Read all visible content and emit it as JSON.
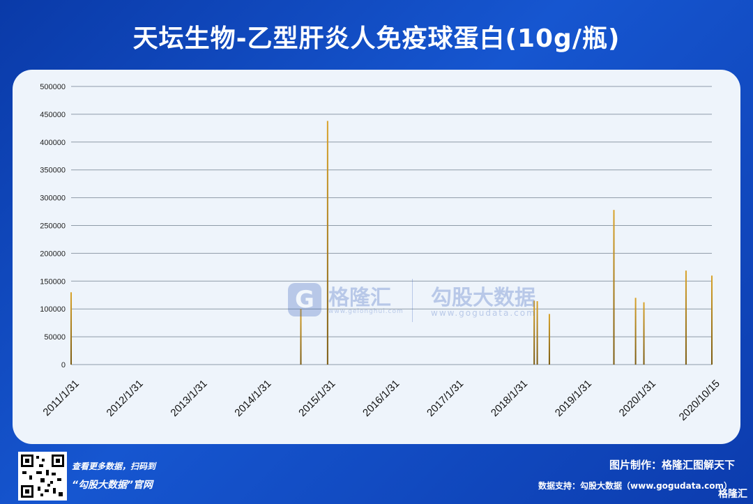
{
  "header": {
    "title": "天坛生物-乙型肝炎人免疫球蛋白(10g/瓶)"
  },
  "watermark": {
    "brand1": "格隆汇",
    "url1": "www.gelonghui.com",
    "brand2": "勾股大数据",
    "url2": "www.gogudata.com",
    "logo_letter": "G"
  },
  "footer": {
    "scan_text": "查看更多数据，扫码到",
    "site_text": "“勾股大数据”官网",
    "made_by": "图片制作：格隆汇图解天下",
    "data_support": "数据支持：勾股大数据（www.gogudata.com）",
    "corner_logo": "格隆汇"
  },
  "colors": {
    "bar": "#d9a32a",
    "bar_dark": "#7a5a10",
    "grid": "#8e9aa8",
    "panel": "#eef4fb"
  },
  "chart_data": {
    "type": "bar",
    "title": "天坛生物-乙型肝炎人免疫球蛋白(10g/瓶)",
    "ylim": [
      0,
      500000
    ],
    "yticks": [
      0,
      50000,
      100000,
      150000,
      200000,
      250000,
      300000,
      350000,
      400000,
      450000,
      500000
    ],
    "xlim": [
      "2011-01-31",
      "2020-10-15"
    ],
    "xtick_labels": [
      "2011/1/31",
      "2012/1/31",
      "2013/1/31",
      "2014/1/31",
      "2015/1/31",
      "2016/1/31",
      "2017/1/31",
      "2018/1/31",
      "2019/1/31",
      "2020/1/31",
      "2020/10/15"
    ],
    "grid": true,
    "bars": [
      {
        "date": "2011-01-31",
        "value": 130000
      },
      {
        "date": "2014-07-25",
        "value": 100000
      },
      {
        "date": "2014-12-20",
        "value": 438000
      },
      {
        "date": "2018-02-05",
        "value": 115000
      },
      {
        "date": "2018-02-22",
        "value": 114000
      },
      {
        "date": "2018-04-30",
        "value": 91000
      },
      {
        "date": "2019-04-22",
        "value": 278000
      },
      {
        "date": "2019-08-20",
        "value": 120000
      },
      {
        "date": "2019-10-05",
        "value": 112000
      },
      {
        "date": "2020-05-25",
        "value": 169000
      },
      {
        "date": "2020-10-15",
        "value": 160000
      }
    ]
  }
}
